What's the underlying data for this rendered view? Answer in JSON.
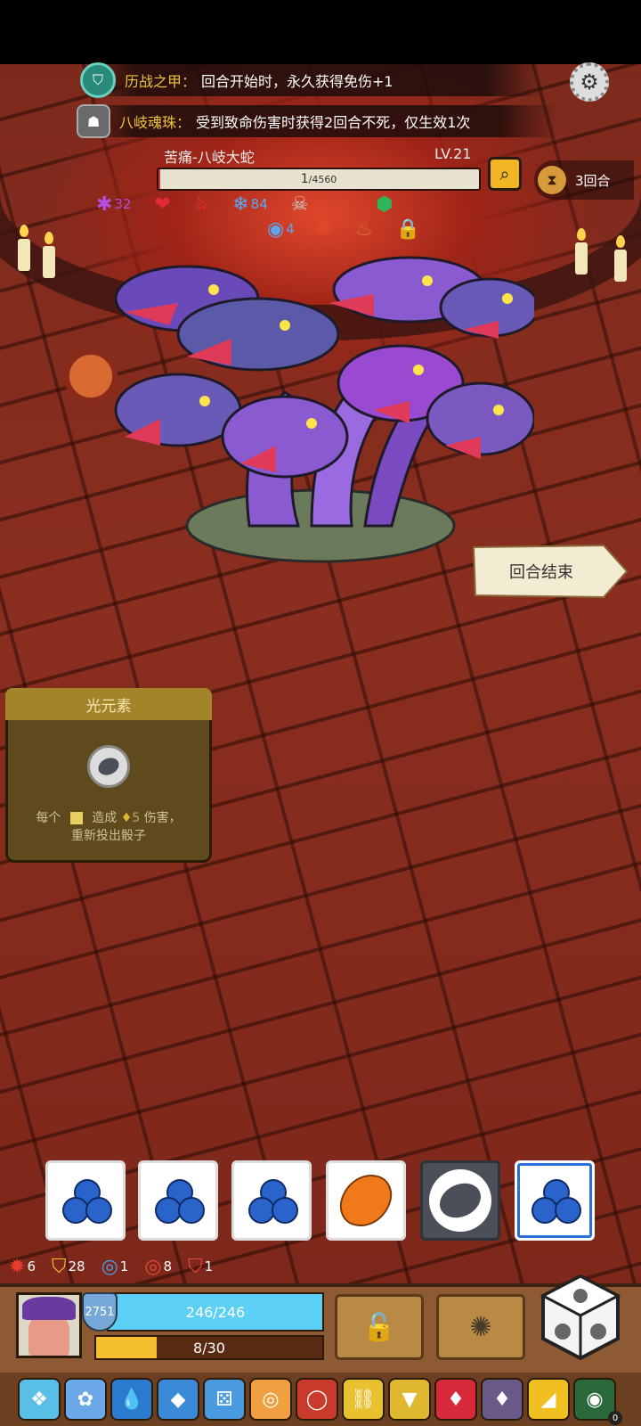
{
  "relics_banner": [
    {
      "name": "历战之甲：",
      "desc": "回合开始时，永久获得免伤+1"
    },
    {
      "name": "八岐魂珠：",
      "desc": "受到致命伤害时获得2回合不死，仅生效1次"
    }
  ],
  "boss": {
    "name": "苦痛-八岐大蛇",
    "level": "LV.21",
    "hp_current": "1",
    "hp_max": "/4560",
    "hp_fraction": 0.0002
  },
  "round": {
    "label": "3回合"
  },
  "boss_stats": {
    "row1": [
      {
        "icon": "purple-burst-icon",
        "glyph": "✱",
        "value": "32",
        "color": "#b44de0"
      },
      {
        "icon": "red-heart-icon",
        "glyph": "❤",
        "value": "",
        "color": "#e02a3a"
      },
      {
        "icon": "red-claw-icon",
        "glyph": "ঌ",
        "value": "",
        "color": "#e02a3a"
      },
      {
        "icon": "blue-frost-icon",
        "glyph": "❄",
        "value": "84",
        "color": "#5aa8f0"
      },
      {
        "icon": "skull-icon",
        "glyph": "☠",
        "value": "",
        "color": "#cccccc"
      },
      {
        "icon": "fire-icon",
        "glyph": "♨",
        "value": "",
        "color": "#e04a2a"
      },
      {
        "icon": "green-shield-icon",
        "glyph": "⬢",
        "value": "",
        "color": "#2fb55a"
      }
    ],
    "row2": [
      {
        "icon": "blue-eyes-icon",
        "glyph": "◉",
        "value": "4",
        "color": "#5aa8f0"
      },
      {
        "icon": "red-flame-icon",
        "glyph": "✺",
        "value": "",
        "color": "#e04a2a"
      },
      {
        "icon": "orange-flame-icon",
        "glyph": "♨",
        "value": "",
        "color": "#e0702a"
      },
      {
        "icon": "lock-icon",
        "glyph": "🔒",
        "value": "",
        "color": "#e0b02a"
      }
    ]
  },
  "end_turn": {
    "label": "回合结束"
  },
  "element_card": {
    "title": "光元素",
    "desc_line1_a": "每个",
    "desc_line1_b": "造成",
    "desc_line1_c": "5",
    "desc_line1_d": "伤害，",
    "desc_line2": "重新投出骰子"
  },
  "dice": [
    {
      "face": "blue-berries",
      "selected": false,
      "edge": false
    },
    {
      "face": "blue-berries",
      "selected": false,
      "edge": false
    },
    {
      "face": "blue-berries",
      "selected": false,
      "edge": false
    },
    {
      "face": "orange-seed",
      "selected": false,
      "edge": false
    },
    {
      "face": "gray-stone",
      "selected": true,
      "edge": false
    },
    {
      "face": "blue-berries",
      "selected": false,
      "edge": true
    }
  ],
  "player_stats": [
    {
      "icon": "red-gear-icon",
      "glyph": "✹",
      "value": "6",
      "color": "#e63b2e"
    },
    {
      "icon": "yellow-shield-icon",
      "glyph": "⛉",
      "value": "28",
      "color": "#f4c22b"
    },
    {
      "icon": "blue-swirl-icon",
      "glyph": "◎",
      "value": "1",
      "color": "#4aa0f0"
    },
    {
      "icon": "red-swirl-icon",
      "glyph": "◎",
      "value": "8",
      "color": "#e04a3a"
    },
    {
      "icon": "red-shield-icon",
      "glyph": "⛉",
      "value": "1",
      "color": "#e04a3a"
    }
  ],
  "player": {
    "armor": "2751",
    "hp": "246/246",
    "energy": "8/30",
    "energy_fraction": 0.2667
  },
  "relic_strip": {
    "badge_count": "0",
    "items": [
      {
        "icon": "ice-crystal-icon",
        "color": "#5ac0e8",
        "glyph": "❖"
      },
      {
        "icon": "blue-fish-icon",
        "color": "#6aa8e8",
        "glyph": "✿"
      },
      {
        "icon": "water-drop-icon",
        "color": "#2a7ad0",
        "glyph": "💧"
      },
      {
        "icon": "blue-cube-icon",
        "color": "#3a8ad8",
        "glyph": "◆"
      },
      {
        "icon": "blue-die-icon",
        "color": "#4a9ae0",
        "glyph": "⚄"
      },
      {
        "icon": "orange-target-icon",
        "color": "#f0a040",
        "glyph": "◎"
      },
      {
        "icon": "red-ring-icon",
        "color": "#c83a2a",
        "glyph": "◯"
      },
      {
        "icon": "gold-chain-icon",
        "color": "#e8c030",
        "glyph": "⛓"
      },
      {
        "icon": "amulet-icon",
        "color": "#e0b830",
        "glyph": "▼"
      },
      {
        "icon": "red-gem-icon",
        "color": "#d82a3a",
        "glyph": "♦"
      },
      {
        "icon": "dark-crystal-icon",
        "color": "#6a5a8a",
        "glyph": "♦"
      },
      {
        "icon": "cheese-icon",
        "color": "#f0c020",
        "glyph": "◢"
      },
      {
        "icon": "green-ring-icon",
        "color": "#2a6a3a",
        "glyph": "◉"
      }
    ]
  }
}
